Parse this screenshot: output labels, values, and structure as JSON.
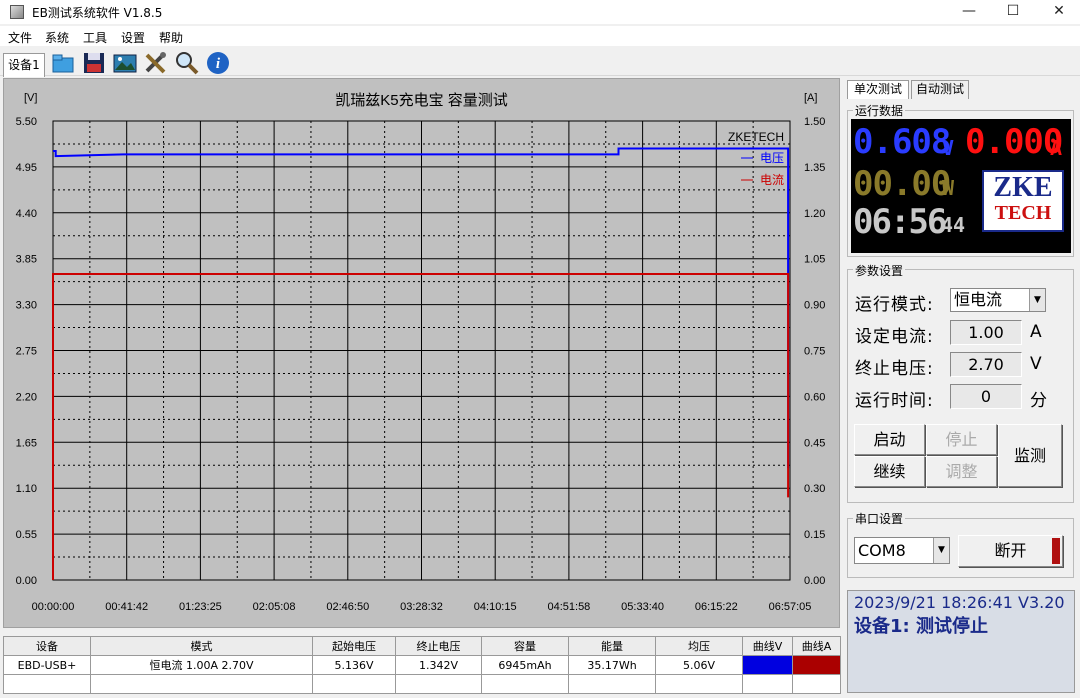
{
  "window": {
    "title": "EB测试系统软件 V1.8.5",
    "minimize_glyph": "—",
    "maximize_glyph": "☐",
    "close_glyph": "✕"
  },
  "menu": [
    "文件",
    "系统",
    "工具",
    "设置",
    "帮助"
  ],
  "toolbar": {
    "device_tab": "设备1",
    "icons": [
      "open-folder-icon",
      "save-icon",
      "picture-icon",
      "tools-icon",
      "magnifier-icon",
      "info-icon"
    ],
    "info_glyph": "i"
  },
  "chart_data": {
    "type": "line",
    "title": "凯瑞兹K5充电宝  容量测试",
    "y_left_unit": "[V]",
    "y_right_unit": "[A]",
    "watermark": "ZKETECH",
    "y_left_ticks": [
      "5.50",
      "4.95",
      "4.40",
      "3.85",
      "3.30",
      "2.75",
      "2.20",
      "1.65",
      "1.10",
      "0.55",
      "0.00"
    ],
    "y_right_ticks": [
      "1.50",
      "1.35",
      "1.20",
      "1.05",
      "0.90",
      "0.75",
      "0.60",
      "0.45",
      "0.30",
      "0.15",
      "0.00"
    ],
    "x_ticks": [
      "00:00:00",
      "00:41:42",
      "01:23:25",
      "02:05:08",
      "02:46:50",
      "03:28:32",
      "04:10:15",
      "04:51:58",
      "05:33:40",
      "06:15:22",
      "06:57:05"
    ],
    "ylim_left": [
      0,
      5.5
    ],
    "ylim_right": [
      0,
      1.5
    ],
    "xlim_minutes": [
      0,
      417.08
    ],
    "series": [
      {
        "name": "电压",
        "axis": "left",
        "color": "#0000ff",
        "points": [
          [
            0,
            5.14
          ],
          [
            1.5,
            5.14
          ],
          [
            1.5,
            5.08
          ],
          [
            40,
            5.1
          ],
          [
            320,
            5.1
          ],
          [
            320,
            5.17
          ],
          [
            416,
            5.17
          ],
          [
            416,
            1.34
          ]
        ]
      },
      {
        "name": "电流",
        "axis": "right",
        "color": "#cc0000",
        "points": [
          [
            0,
            0
          ],
          [
            0,
            1.0
          ],
          [
            416,
            1.0
          ],
          [
            416,
            0.27
          ]
        ]
      }
    ]
  },
  "table": {
    "headers": [
      "设备",
      "模式",
      "起始电压",
      "终止电压",
      "容量",
      "能量",
      "均压",
      "曲线V",
      "曲线A"
    ],
    "rows": [
      [
        "EBD-USB+",
        "恒电流  1.00A  2.70V",
        "5.136V",
        "1.342V",
        "6945mAh",
        "35.17Wh",
        "5.06V",
        "",
        ""
      ]
    ],
    "curve_colors": [
      "#0000e0",
      "#aa0000"
    ]
  },
  "right_panel": {
    "tabs": [
      "单次测试",
      "自动测试"
    ],
    "run_data": {
      "title": "运行数据",
      "voltage": "0.608",
      "voltage_unit": "V",
      "current": "0.000",
      "current_unit": "A",
      "power": "00.00",
      "power_unit": "W",
      "time_main": "06:56",
      "time_sec": "44",
      "voltage_color": "#2a3cff",
      "current_color": "#ff1010",
      "power_color": "#8a7a2a",
      "time_color": "#c8c8c8",
      "logo_line1": "ZKE",
      "logo_line2": "TECH"
    },
    "params": {
      "title": "参数设置",
      "mode_label": "运行模式:",
      "mode_value": "恒电流",
      "current_label": "设定电流:",
      "current_value": "1.00",
      "current_unit": "A",
      "cutoff_label": "终止电压:",
      "cutoff_value": "2.70",
      "cutoff_unit": "V",
      "time_label": "运行时间:",
      "time_value": "0",
      "time_unit": "分",
      "buttons": {
        "start": "启动",
        "stop": "停止",
        "continue": "继续",
        "adjust": "调整",
        "monitor": "监测"
      }
    },
    "serial": {
      "title": "串口设置",
      "port": "COM8",
      "disconnect": "断开"
    },
    "status": {
      "datetime": "2023/9/21 18:26:41",
      "version": "V3.20",
      "message": "设备1: 测试停止"
    }
  }
}
